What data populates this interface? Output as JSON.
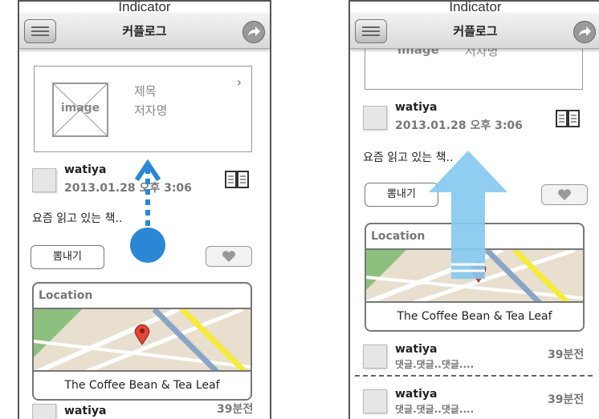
{
  "indicator": "Indicator",
  "nav": {
    "title": "커플로그"
  },
  "book": {
    "image_label": "image",
    "title": "제목",
    "author": "저자명",
    "chevron": "›"
  },
  "post": {
    "user": "watiya",
    "date": "2013.01.28 오후 3:06",
    "text": "요즘 읽고 있는 책..",
    "brag_label": "뽐내기"
  },
  "location": {
    "header": "Location",
    "place": "The Coffee Bean & Tea Leaf"
  },
  "comments": [
    {
      "user": "watiya",
      "text": "댓글.댓글..댓글....",
      "time": "39분전"
    },
    {
      "user": "watiya",
      "text": "댓글.댓글..댓글....",
      "time": "39분전"
    }
  ],
  "colors": {
    "gesture_blue": "#2b86d6",
    "arrow_blue": "#86c9f0",
    "map_green": "#8dc07e",
    "road_yellow": "#f5ec3a",
    "road_blue": "#8aa6c6",
    "pin_red": "#e2463a"
  }
}
